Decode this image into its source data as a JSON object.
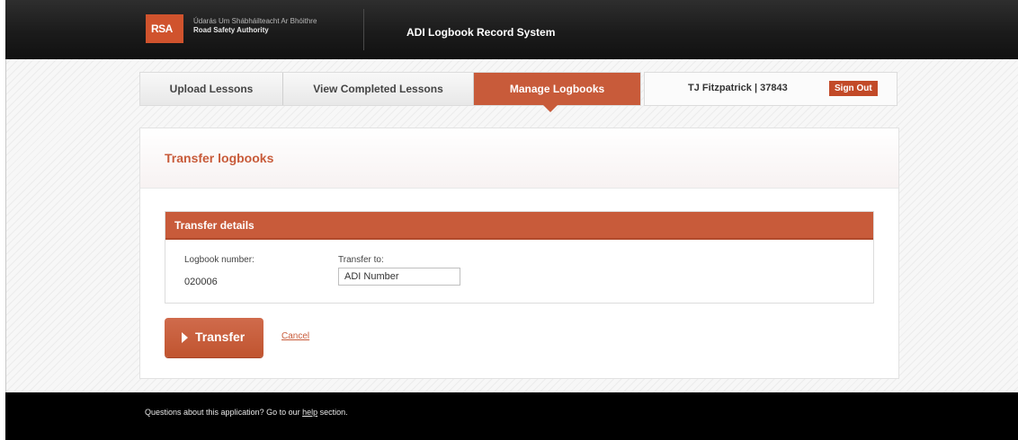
{
  "header": {
    "logo_text": "RSA",
    "org_irish": "Údarás Um Shábháilteacht Ar Bhóithre",
    "org_english": "Road Safety Authority",
    "app_title": "ADI Logbook Record System"
  },
  "nav": {
    "tabs": [
      {
        "label": "Upload Lessons"
      },
      {
        "label": "View Completed Lessons"
      },
      {
        "label": "Manage Logbooks"
      }
    ],
    "active_tab": "Manage Logbooks"
  },
  "user": {
    "label": "TJ Fitzpatrick | 37843",
    "signout_label": "Sign Out"
  },
  "page": {
    "title": "Transfer logbooks"
  },
  "details": {
    "title": "Transfer details",
    "logbook_label": "Logbook number:",
    "logbook_value": "020006",
    "transfer_to_label": "Transfer to:",
    "transfer_to_value": "ADI Number"
  },
  "actions": {
    "transfer_label": "Transfer",
    "cancel_label": "Cancel"
  },
  "footer": {
    "text_before": "Questions about this application? Go to our ",
    "link_label": "help",
    "text_after": " section."
  },
  "colors": {
    "accent": "#c85b3a",
    "header_bg": "#1b1b1b",
    "footer_bg": "#000000"
  }
}
